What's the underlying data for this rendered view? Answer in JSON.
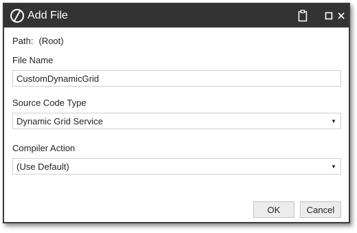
{
  "window": {
    "title": "Add File",
    "icons": {
      "logo": "onestream-logo-icon",
      "clipboard": "clipboard-icon",
      "maximize": "maximize-icon",
      "close": "close-icon"
    },
    "close_glyph": "✕"
  },
  "form": {
    "path_label": "Path:",
    "path_value": "(Root)",
    "file_name_label": "File Name",
    "file_name_value": "CustomDynamicGrid",
    "source_code_type_label": "Source Code Type",
    "source_code_type_value": "Dynamic Grid Service",
    "compiler_action_label": "Compiler Action",
    "compiler_action_value": "(Use Default)",
    "dropdown_glyph": "▼"
  },
  "buttons": {
    "ok_label": "OK",
    "cancel_label": "Cancel"
  },
  "colors": {
    "titlebar": "#333333",
    "title_text": "#ffffff",
    "button_bg": "#ececec"
  }
}
